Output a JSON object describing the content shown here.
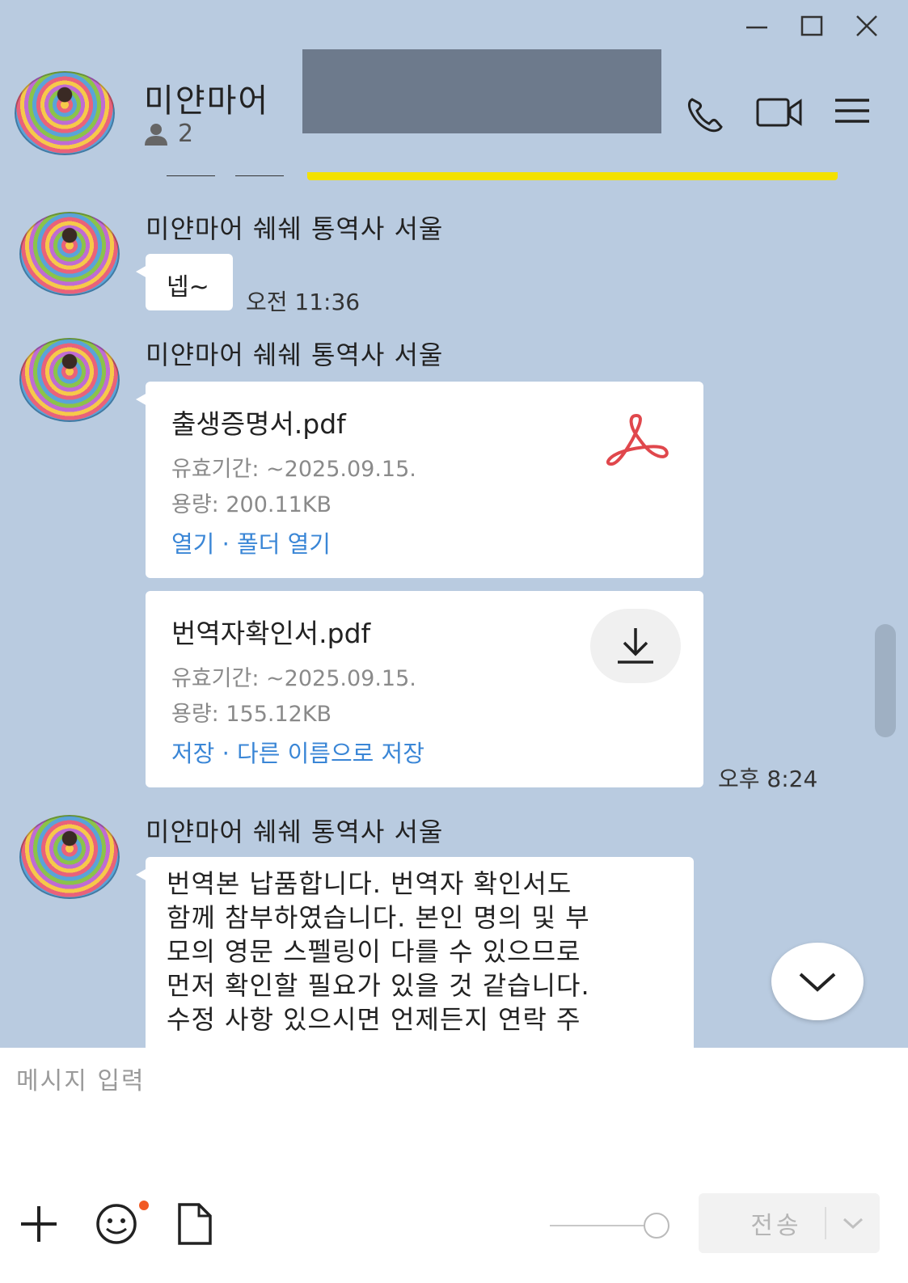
{
  "window": {
    "minimize_label": "—",
    "maximize_label": "□",
    "close_label": "✕"
  },
  "header": {
    "title": "미얀마어 ",
    "member_count": "2",
    "icons": [
      "person-icon",
      "phone-icon",
      "video-icon",
      "menu-icon"
    ]
  },
  "messages": [
    {
      "sender": "미얀마어 쉐쉐 통역사 서울",
      "text": "넵~",
      "time": "오전 11:36"
    },
    {
      "sender": "미얀마어 쉐쉐 통역사 서울",
      "files": [
        {
          "name": "출생증명서.pdf",
          "expiry": "유효기간: ~2025.09.15.",
          "size": "용량: 200.11KB",
          "action1": "열기",
          "separator": " · ",
          "action2": "폴더 열기",
          "icon": "pdf-icon"
        },
        {
          "name": "번역자확인서.pdf",
          "expiry": "유효기간: ~2025.09.15.",
          "size": "용량: 155.12KB",
          "action1": "저장",
          "separator": " · ",
          "action2": "다른 이름으로 저장",
          "icon": "download-icon"
        }
      ],
      "time": "오후 8:24"
    },
    {
      "sender": "미얀마어 쉐쉐 통역사 서울",
      "lines": [
        "번역본 납품합니다. 번역자 확인서도",
        "함께 참부하였습니다. 본인 명의 및 부",
        "모의 영문 스펠링이 다를 수 있으므로",
        "먼저 확인할 필요가 있을 것 같습니다.",
        "수정 사항 있으시면 언제든지 연락 주"
      ]
    }
  ],
  "input": {
    "placeholder": "메시지 입력",
    "send_label": "전송"
  },
  "colors": {
    "background": "#b9cbe0",
    "link": "#3a86d6",
    "pdf_red": "#e0474c",
    "notification_dot": "#f15a24"
  }
}
